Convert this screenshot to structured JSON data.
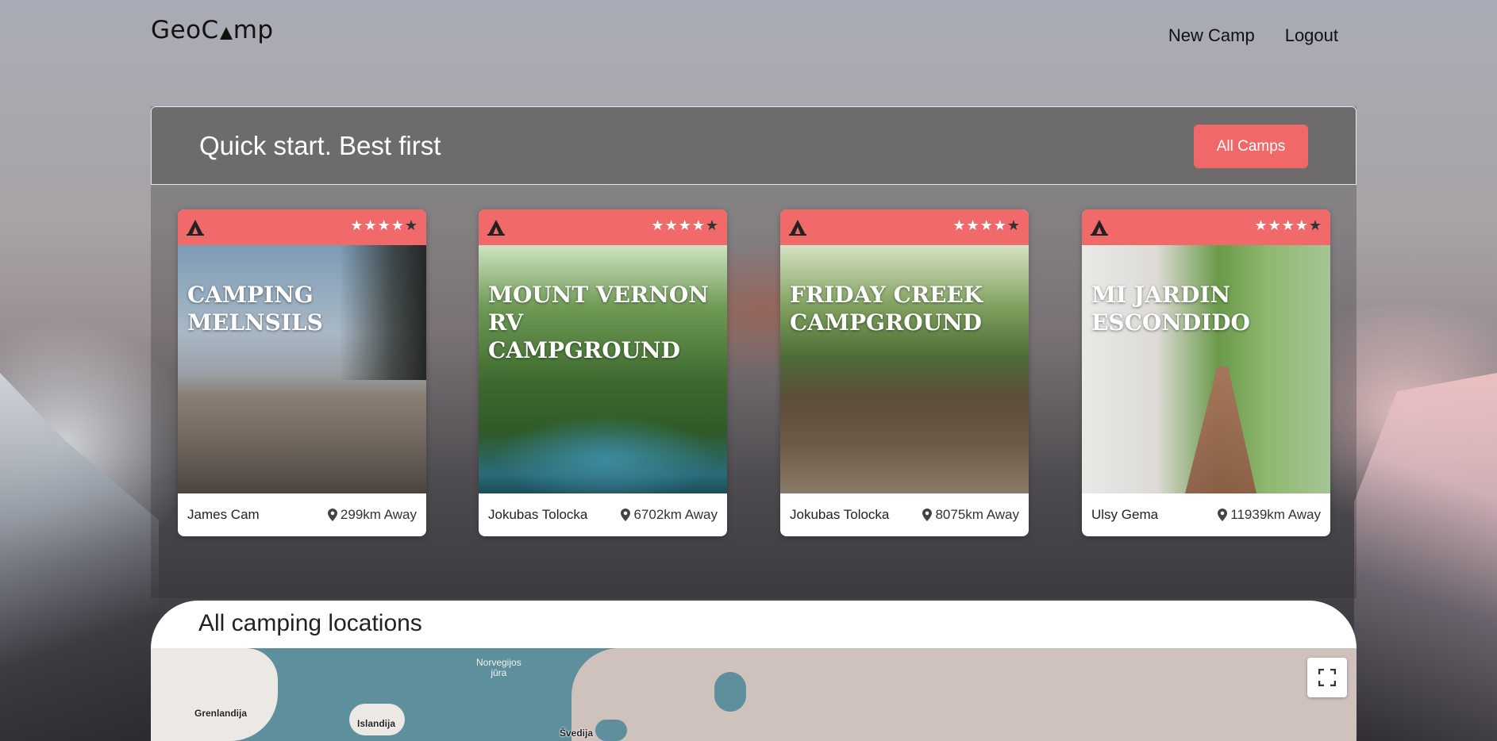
{
  "nav": {
    "brand_left": "GeoC",
    "brand_right": "mp",
    "links": [
      "New Camp",
      "Logout"
    ]
  },
  "hero": {
    "title": "Quick start. Best first",
    "button": "All Camps"
  },
  "camps": [
    {
      "title": "CAMPING MELNSILS",
      "author": "James Cam",
      "distance": "299km Away",
      "rating": 4
    },
    {
      "title": "MOUNT VERNON RV CAMPGROUND",
      "author": "Jokubas Tolocka",
      "distance": "6702km Away",
      "rating": 4
    },
    {
      "title": "FRIDAY CREEK CAMPGROUND",
      "author": "Jokubas Tolocka",
      "distance": "8075km Away",
      "rating": 4
    },
    {
      "title": "MI JARDIN ESCONDIDO",
      "author": "Ulsy Gema",
      "distance": "11939km Away",
      "rating": 4
    }
  ],
  "stars": {
    "on": "★★★★",
    "off": "★"
  },
  "map": {
    "title": "All camping locations",
    "labels": {
      "greenland": "Grenlandija",
      "iceland": "Islandija",
      "sweden": "Švedija",
      "norwegian_sea_1": "Norvegijos",
      "norwegian_sea_2": "jūra"
    }
  },
  "colors": {
    "accent": "#f06868",
    "header_panel": "#696767"
  }
}
